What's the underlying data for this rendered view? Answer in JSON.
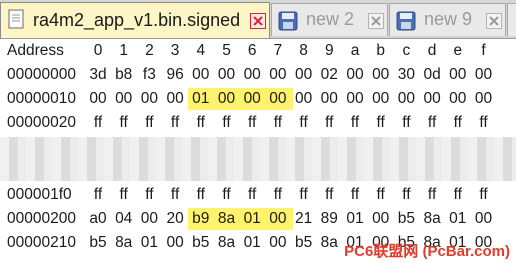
{
  "tabs": [
    {
      "label": "ra4m2_app_v1.bin.signed",
      "active": true
    },
    {
      "label": "new 2",
      "active": false
    },
    {
      "label": "new 9",
      "active": false
    }
  ],
  "header": {
    "address_label": "Address",
    "columns": [
      "0",
      "1",
      "2",
      "3",
      "4",
      "5",
      "6",
      "7",
      "8",
      "9",
      "a",
      "b",
      "c",
      "d",
      "e",
      "f"
    ]
  },
  "rows": [
    {
      "address": "00000000",
      "bytes": [
        "3d",
        "b8",
        "f3",
        "96",
        "00",
        "00",
        "00",
        "00",
        "00",
        "02",
        "00",
        "00",
        "30",
        "0d",
        "00",
        "00"
      ]
    },
    {
      "address": "00000010",
      "bytes": [
        "00",
        "00",
        "00",
        "00",
        "01",
        "00",
        "00",
        "00",
        "00",
        "00",
        "00",
        "00",
        "00",
        "00",
        "00",
        "00"
      ]
    },
    {
      "address": "00000020",
      "bytes": [
        "ff",
        "ff",
        "ff",
        "ff",
        "ff",
        "ff",
        "ff",
        "ff",
        "ff",
        "ff",
        "ff",
        "ff",
        "ff",
        "ff",
        "ff",
        "ff"
      ]
    },
    {
      "address": "000001f0",
      "bytes": [
        "ff",
        "ff",
        "ff",
        "ff",
        "ff",
        "ff",
        "ff",
        "ff",
        "ff",
        "ff",
        "ff",
        "ff",
        "ff",
        "ff",
        "ff",
        "ff"
      ]
    },
    {
      "address": "00000200",
      "bytes": [
        "a0",
        "04",
        "00",
        "20",
        "b9",
        "8a",
        "01",
        "00",
        "21",
        "89",
        "01",
        "00",
        "b5",
        "8a",
        "01",
        "00"
      ]
    },
    {
      "address": "00000210",
      "bytes": [
        "b5",
        "8a",
        "01",
        "00",
        "b5",
        "8a",
        "01",
        "00",
        "b5",
        "8a",
        "01",
        "00",
        "b5",
        "8a",
        "01",
        "00"
      ]
    }
  ],
  "highlights": [
    {
      "row": 1,
      "from": 4,
      "to": 7
    },
    {
      "row": 4,
      "from": 4,
      "to": 7
    }
  ],
  "colors": {
    "highlight": "#fff36d",
    "active_tab": "#fff6c8",
    "close_red": "#d9262d"
  },
  "watermark": "PC6联盟网 (PcBar.com)"
}
